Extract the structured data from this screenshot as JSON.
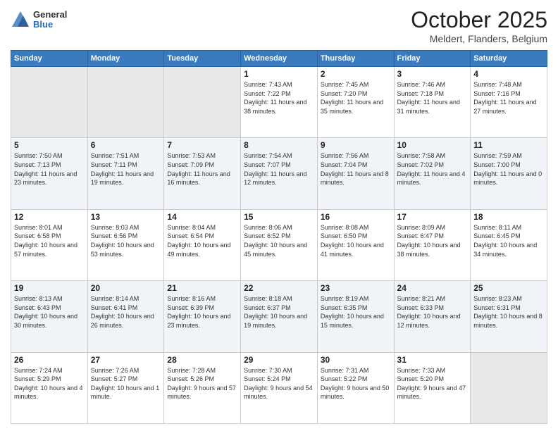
{
  "header": {
    "logo": {
      "general": "General",
      "blue": "Blue"
    },
    "title": "October 2025",
    "location": "Meldert, Flanders, Belgium"
  },
  "weekdays": [
    "Sunday",
    "Monday",
    "Tuesday",
    "Wednesday",
    "Thursday",
    "Friday",
    "Saturday"
  ],
  "weeks": [
    [
      {
        "day": "",
        "sunrise": "",
        "sunset": "",
        "daylight": ""
      },
      {
        "day": "",
        "sunrise": "",
        "sunset": "",
        "daylight": ""
      },
      {
        "day": "",
        "sunrise": "",
        "sunset": "",
        "daylight": ""
      },
      {
        "day": "1",
        "sunrise": "Sunrise: 7:43 AM",
        "sunset": "Sunset: 7:22 PM",
        "daylight": "Daylight: 11 hours and 38 minutes."
      },
      {
        "day": "2",
        "sunrise": "Sunrise: 7:45 AM",
        "sunset": "Sunset: 7:20 PM",
        "daylight": "Daylight: 11 hours and 35 minutes."
      },
      {
        "day": "3",
        "sunrise": "Sunrise: 7:46 AM",
        "sunset": "Sunset: 7:18 PM",
        "daylight": "Daylight: 11 hours and 31 minutes."
      },
      {
        "day": "4",
        "sunrise": "Sunrise: 7:48 AM",
        "sunset": "Sunset: 7:16 PM",
        "daylight": "Daylight: 11 hours and 27 minutes."
      }
    ],
    [
      {
        "day": "5",
        "sunrise": "Sunrise: 7:50 AM",
        "sunset": "Sunset: 7:13 PM",
        "daylight": "Daylight: 11 hours and 23 minutes."
      },
      {
        "day": "6",
        "sunrise": "Sunrise: 7:51 AM",
        "sunset": "Sunset: 7:11 PM",
        "daylight": "Daylight: 11 hours and 19 minutes."
      },
      {
        "day": "7",
        "sunrise": "Sunrise: 7:53 AM",
        "sunset": "Sunset: 7:09 PM",
        "daylight": "Daylight: 11 hours and 16 minutes."
      },
      {
        "day": "8",
        "sunrise": "Sunrise: 7:54 AM",
        "sunset": "Sunset: 7:07 PM",
        "daylight": "Daylight: 11 hours and 12 minutes."
      },
      {
        "day": "9",
        "sunrise": "Sunrise: 7:56 AM",
        "sunset": "Sunset: 7:04 PM",
        "daylight": "Daylight: 11 hours and 8 minutes."
      },
      {
        "day": "10",
        "sunrise": "Sunrise: 7:58 AM",
        "sunset": "Sunset: 7:02 PM",
        "daylight": "Daylight: 11 hours and 4 minutes."
      },
      {
        "day": "11",
        "sunrise": "Sunrise: 7:59 AM",
        "sunset": "Sunset: 7:00 PM",
        "daylight": "Daylight: 11 hours and 0 minutes."
      }
    ],
    [
      {
        "day": "12",
        "sunrise": "Sunrise: 8:01 AM",
        "sunset": "Sunset: 6:58 PM",
        "daylight": "Daylight: 10 hours and 57 minutes."
      },
      {
        "day": "13",
        "sunrise": "Sunrise: 8:03 AM",
        "sunset": "Sunset: 6:56 PM",
        "daylight": "Daylight: 10 hours and 53 minutes."
      },
      {
        "day": "14",
        "sunrise": "Sunrise: 8:04 AM",
        "sunset": "Sunset: 6:54 PM",
        "daylight": "Daylight: 10 hours and 49 minutes."
      },
      {
        "day": "15",
        "sunrise": "Sunrise: 8:06 AM",
        "sunset": "Sunset: 6:52 PM",
        "daylight": "Daylight: 10 hours and 45 minutes."
      },
      {
        "day": "16",
        "sunrise": "Sunrise: 8:08 AM",
        "sunset": "Sunset: 6:50 PM",
        "daylight": "Daylight: 10 hours and 41 minutes."
      },
      {
        "day": "17",
        "sunrise": "Sunrise: 8:09 AM",
        "sunset": "Sunset: 6:47 PM",
        "daylight": "Daylight: 10 hours and 38 minutes."
      },
      {
        "day": "18",
        "sunrise": "Sunrise: 8:11 AM",
        "sunset": "Sunset: 6:45 PM",
        "daylight": "Daylight: 10 hours and 34 minutes."
      }
    ],
    [
      {
        "day": "19",
        "sunrise": "Sunrise: 8:13 AM",
        "sunset": "Sunset: 6:43 PM",
        "daylight": "Daylight: 10 hours and 30 minutes."
      },
      {
        "day": "20",
        "sunrise": "Sunrise: 8:14 AM",
        "sunset": "Sunset: 6:41 PM",
        "daylight": "Daylight: 10 hours and 26 minutes."
      },
      {
        "day": "21",
        "sunrise": "Sunrise: 8:16 AM",
        "sunset": "Sunset: 6:39 PM",
        "daylight": "Daylight: 10 hours and 23 minutes."
      },
      {
        "day": "22",
        "sunrise": "Sunrise: 8:18 AM",
        "sunset": "Sunset: 6:37 PM",
        "daylight": "Daylight: 10 hours and 19 minutes."
      },
      {
        "day": "23",
        "sunrise": "Sunrise: 8:19 AM",
        "sunset": "Sunset: 6:35 PM",
        "daylight": "Daylight: 10 hours and 15 minutes."
      },
      {
        "day": "24",
        "sunrise": "Sunrise: 8:21 AM",
        "sunset": "Sunset: 6:33 PM",
        "daylight": "Daylight: 10 hours and 12 minutes."
      },
      {
        "day": "25",
        "sunrise": "Sunrise: 8:23 AM",
        "sunset": "Sunset: 6:31 PM",
        "daylight": "Daylight: 10 hours and 8 minutes."
      }
    ],
    [
      {
        "day": "26",
        "sunrise": "Sunrise: 7:24 AM",
        "sunset": "Sunset: 5:29 PM",
        "daylight": "Daylight: 10 hours and 4 minutes."
      },
      {
        "day": "27",
        "sunrise": "Sunrise: 7:26 AM",
        "sunset": "Sunset: 5:27 PM",
        "daylight": "Daylight: 10 hours and 1 minute."
      },
      {
        "day": "28",
        "sunrise": "Sunrise: 7:28 AM",
        "sunset": "Sunset: 5:26 PM",
        "daylight": "Daylight: 9 hours and 57 minutes."
      },
      {
        "day": "29",
        "sunrise": "Sunrise: 7:30 AM",
        "sunset": "Sunset: 5:24 PM",
        "daylight": "Daylight: 9 hours and 54 minutes."
      },
      {
        "day": "30",
        "sunrise": "Sunrise: 7:31 AM",
        "sunset": "Sunset: 5:22 PM",
        "daylight": "Daylight: 9 hours and 50 minutes."
      },
      {
        "day": "31",
        "sunrise": "Sunrise: 7:33 AM",
        "sunset": "Sunset: 5:20 PM",
        "daylight": "Daylight: 9 hours and 47 minutes."
      },
      {
        "day": "",
        "sunrise": "",
        "sunset": "",
        "daylight": ""
      }
    ]
  ]
}
